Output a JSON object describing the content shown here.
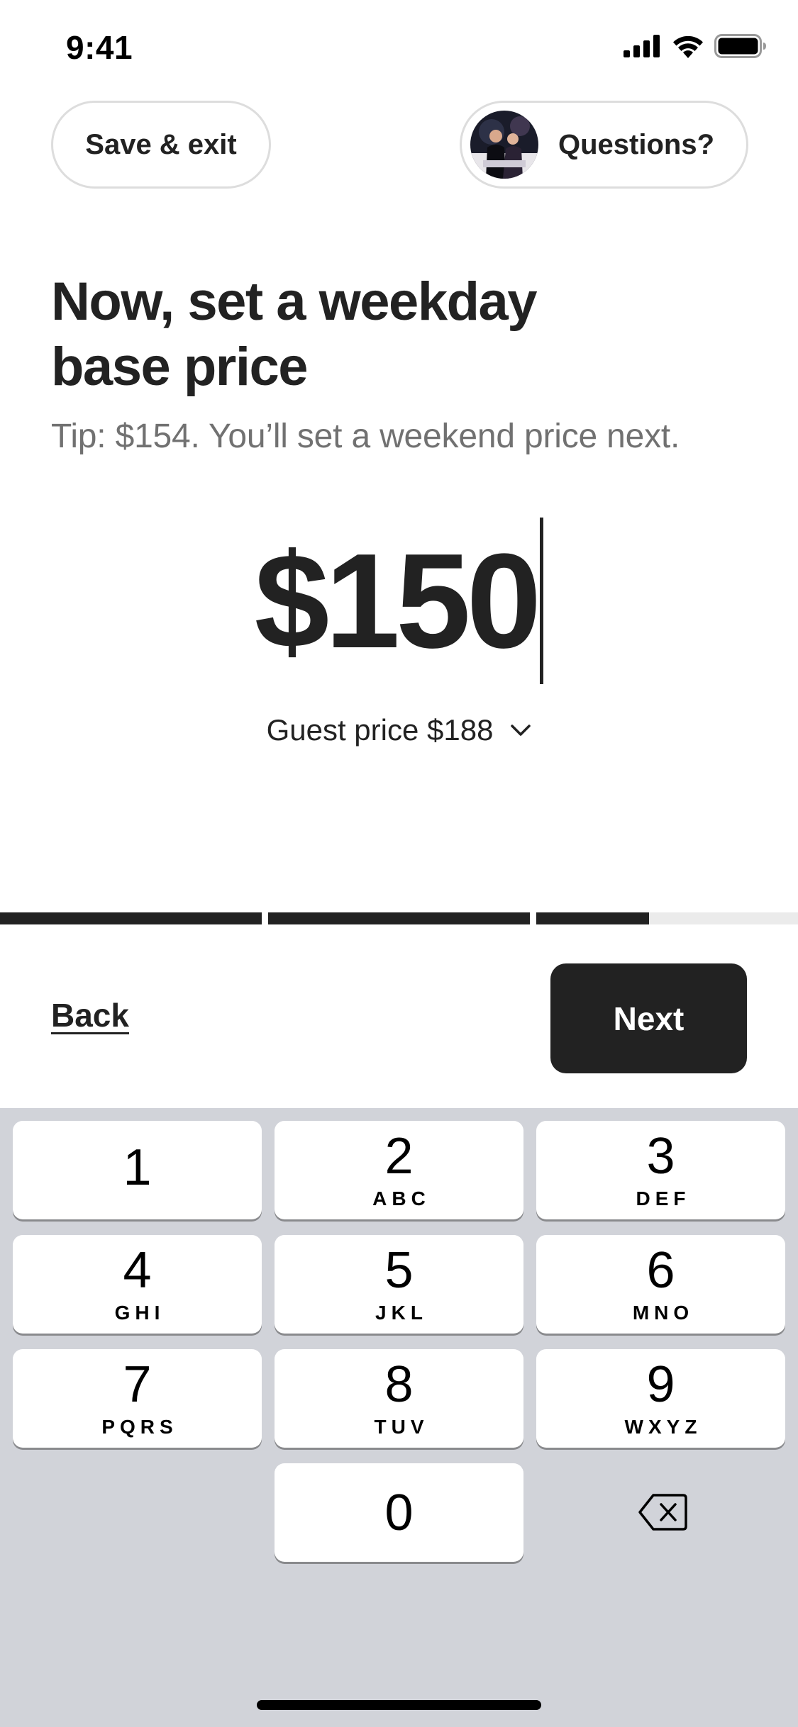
{
  "status_bar": {
    "time": "9:41"
  },
  "top_bar": {
    "save_exit_label": "Save & exit",
    "questions_label": "Questions?"
  },
  "headline": {
    "title_line1": "Now, set a weekday",
    "title_line2": "base price",
    "tip": "Tip: $154. You’ll set a weekend price next."
  },
  "price_input": {
    "value": "$150"
  },
  "guest_price": {
    "label": "Guest price $188"
  },
  "progress": {
    "segments_total": 3,
    "segment_fill": [
      1,
      1,
      0.43
    ]
  },
  "footer": {
    "back_label": "Back",
    "next_label": "Next"
  },
  "keypad": {
    "keys": [
      {
        "num": "1",
        "letters": ""
      },
      {
        "num": "2",
        "letters": "ABC"
      },
      {
        "num": "3",
        "letters": "DEF"
      },
      {
        "num": "4",
        "letters": "GHI"
      },
      {
        "num": "5",
        "letters": "JKL"
      },
      {
        "num": "6",
        "letters": "MNO"
      },
      {
        "num": "7",
        "letters": "PQRS"
      },
      {
        "num": "8",
        "letters": "TUV"
      },
      {
        "num": "9",
        "letters": "WXYZ"
      },
      {
        "num": "0",
        "letters": ""
      }
    ],
    "delete_icon": "backspace-icon"
  },
  "colors": {
    "text": "#222222",
    "muted": "#717171",
    "keyboard_bg": "#d1d3d9",
    "progress_track": "#ebebeb"
  }
}
